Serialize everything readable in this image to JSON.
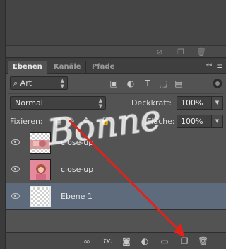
{
  "tabs": [
    {
      "label": "Ebenen",
      "active": true
    },
    {
      "label": "Kanäle",
      "active": false
    },
    {
      "label": "Pfade",
      "active": false
    }
  ],
  "collapse_glyph": "◂◂",
  "panel_menu_glyph": "≡",
  "filter": {
    "kind_icon": "search-icon",
    "value": "Art",
    "icons": [
      "image-filter-icon",
      "adjustment-filter-icon",
      "type-filter-icon",
      "shape-filter-icon",
      "smart-object-filter-icon"
    ]
  },
  "blend": {
    "value": "Normal",
    "opacity_label": "Deckkraft:",
    "opacity_value": "100%"
  },
  "lock": {
    "label": "Fixieren:",
    "fill_label": "Fläche:",
    "fill_value": "100%"
  },
  "layers": [
    {
      "name": "close-up",
      "visible": true,
      "selected": false,
      "thumb": "photo-small"
    },
    {
      "name": "close-up",
      "visible": true,
      "selected": false,
      "thumb": "photo"
    },
    {
      "name": "Ebene 1",
      "visible": true,
      "selected": true,
      "thumb": "transparent"
    }
  ],
  "bottom_icons": [
    "link-icon",
    "fx-icon",
    "mask-icon",
    "adjustment-layer-icon",
    "group-folder-icon",
    "new-layer-icon",
    "trash-icon"
  ],
  "fx_label": "fx.",
  "watermark": "Bonne",
  "colors": {
    "selected_row": "#5d6b7d",
    "arrow": "#e0221b",
    "panel": "#535353"
  }
}
